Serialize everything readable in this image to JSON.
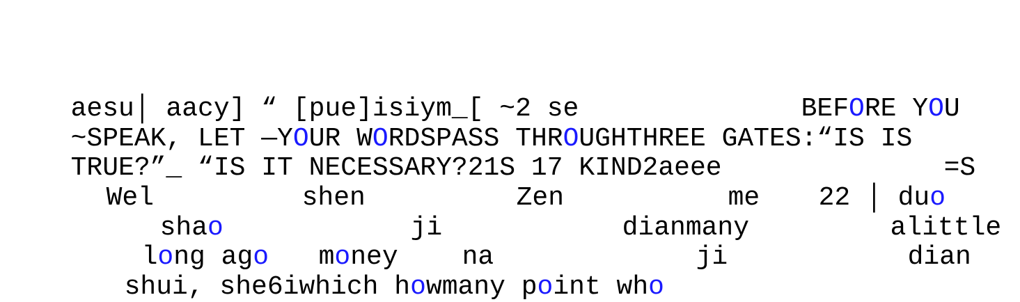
{
  "colors": {
    "text": "#000000",
    "accent": "#1a1aff",
    "background": "#ffffff"
  },
  "lines": [
    [
      {
        "t": "aesu│ aacy] “ [pue]isiym_[ ~2 se",
        "c": 0
      },
      {
        "t": "BEF",
        "c": 0
      },
      {
        "t": "O",
        "c": 1
      },
      {
        "t": "RE Y",
        "c": 0
      },
      {
        "t": "O",
        "c": 1
      },
      {
        "t": "U",
        "c": 0
      }
    ],
    [
      {
        "t": "~SPEAK, LET —Y",
        "c": 0
      },
      {
        "t": "O",
        "c": 1
      },
      {
        "t": "UR W",
        "c": 0
      },
      {
        "t": "O",
        "c": 1
      },
      {
        "t": "RDSPASS THR",
        "c": 0
      },
      {
        "t": "O",
        "c": 1
      },
      {
        "t": "UGHTHREE GATES:“IS IS",
        "c": 0
      }
    ],
    [
      {
        "t": "TRUE?”_ “IS IT NECESSARY?21S 17 KIND2aeee",
        "c": 0
      },
      {
        "t": "=S",
        "c": 0
      }
    ],
    [
      {
        "t": "Wel",
        "c": 0
      },
      {
        "t": "shen",
        "c": 0
      },
      {
        "t": "Zen",
        "c": 0
      },
      {
        "t": "me",
        "c": 0
      },
      {
        "t": "22 │ du",
        "c": 0
      },
      {
        "t": "o",
        "c": 1
      }
    ],
    [
      {
        "t": "sha",
        "c": 0
      },
      {
        "t": "o",
        "c": 1
      },
      {
        "t": "ji",
        "c": 0
      },
      {
        "t": "dianmany",
        "c": 0
      },
      {
        "t": "alittle",
        "c": 0
      }
    ],
    [
      {
        "t": "l",
        "c": 0
      },
      {
        "t": "o",
        "c": 1
      },
      {
        "t": "ng ag",
        "c": 0
      },
      {
        "t": "o",
        "c": 1
      },
      {
        "t": "m",
        "c": 0
      },
      {
        "t": "o",
        "c": 1
      },
      {
        "t": "ney",
        "c": 0
      },
      {
        "t": "na",
        "c": 0
      },
      {
        "t": "ji",
        "c": 0
      },
      {
        "t": "dian",
        "c": 0
      }
    ],
    [
      {
        "t": "shui, she6iwhich h",
        "c": 0
      },
      {
        "t": "o",
        "c": 1
      },
      {
        "t": "wmany p",
        "c": 0
      },
      {
        "t": "o",
        "c": 1
      },
      {
        "t": "int wh",
        "c": 0
      },
      {
        "t": "o",
        "c": 1
      }
    ]
  ]
}
